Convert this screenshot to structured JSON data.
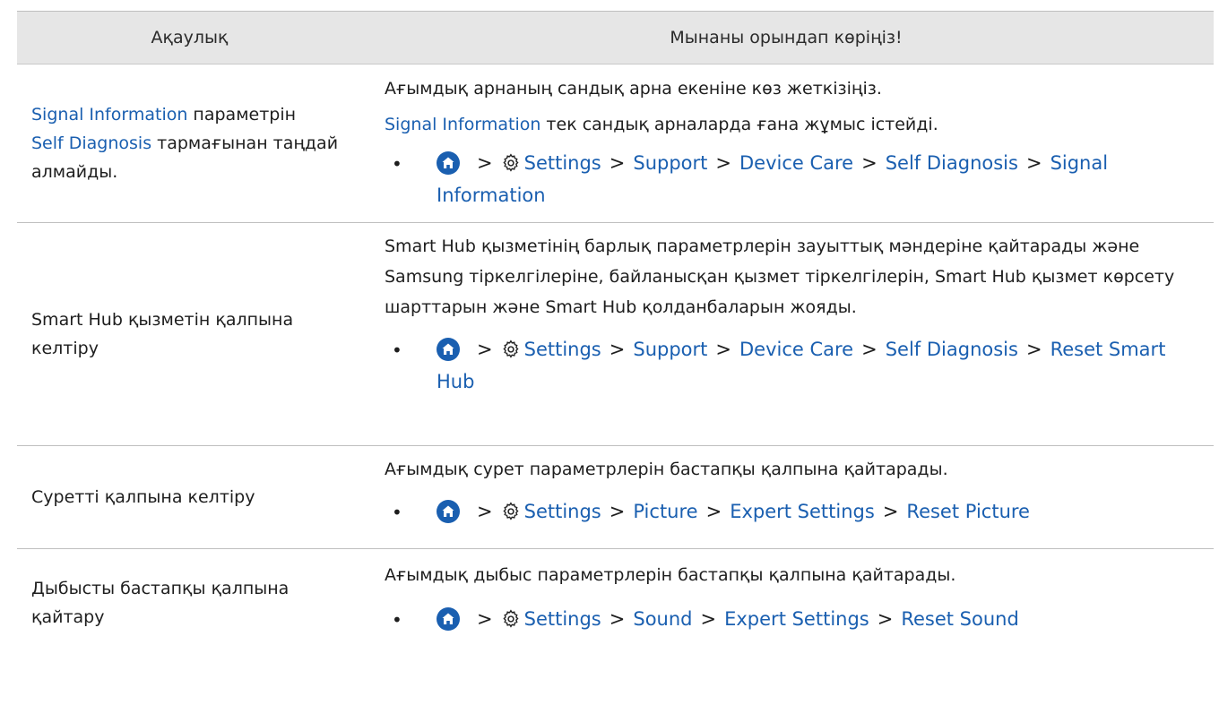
{
  "header": {
    "col1": "Ақаулық",
    "col2": "Мынаны орындап көріңіз!"
  },
  "rows": [
    {
      "problem_link1": "Signal Information",
      "problem_text1": " параметрін",
      "problem_link2": "Self Diagnosis",
      "problem_text2": " тармағынан таңдай алмайды.",
      "solution_p1": "Ағымдық арнаның сандық арна екеніне көз жеткізіңіз.",
      "solution_p2_link": "Signal Information",
      "solution_p2_text": " тек сандық арналарда ғана жұмыс істейді.",
      "path": [
        "Settings",
        "Support",
        "Device Care",
        "Self Diagnosis",
        "Signal Information"
      ]
    },
    {
      "problem": "Smart Hub қызметін қалпына келтіру",
      "solution": "Smart Hub қызметінің барлық параметрлерін зауыттық мәндеріне қайтарады және Samsung тіркелгілеріне, байланысқан қызмет тіркелгілерін, Smart Hub қызмет көрсету шарттарын және Smart Hub қолданбаларын жояды.",
      "path": [
        "Settings",
        "Support",
        "Device Care",
        "Self Diagnosis",
        "Reset Smart Hub"
      ]
    },
    {
      "problem": "Суретті қалпына келтіру",
      "solution": "Ағымдық сурет параметрлерін бастапқы қалпына қайтарады.",
      "path": [
        "Settings",
        "Picture",
        "Expert Settings",
        "Reset Picture"
      ]
    },
    {
      "problem": "Дыбысты бастапқы қалпына қайтару",
      "solution": "Ағымдық дыбыс параметрлерін бастапқы қалпына қайтарады.",
      "path": [
        "Settings",
        "Sound",
        "Expert Settings",
        "Reset Sound"
      ]
    }
  ],
  "bullet": "•",
  "separator": ">",
  "colors": {
    "link": "#1a5fb0",
    "header_bg": "#e6e6e6",
    "border": "#bfbfbf"
  },
  "icons": {
    "home": "home-icon",
    "settings": "gear-icon"
  }
}
